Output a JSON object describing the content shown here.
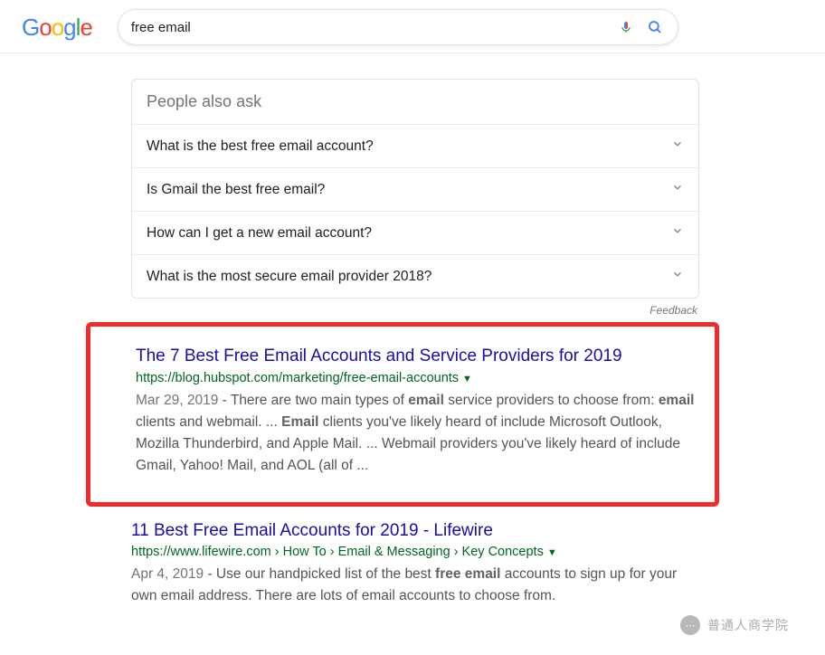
{
  "header": {
    "query": "free email"
  },
  "paa": {
    "title": "People also ask",
    "items": [
      "What is the best free email account?",
      "Is Gmail the best free email?",
      "How can I get a new email account?",
      "What is the most secure email provider 2018?"
    ]
  },
  "feedback_label": "Feedback",
  "results": [
    {
      "title": "The 7 Best Free Email Accounts and Service Providers for 2019",
      "url": "https://blog.hubspot.com/marketing/free-email-accounts",
      "date": "Mar 29, 2019",
      "snippet_parts": [
        " - There are two main types of ",
        "email",
        " service providers to choose from: ",
        "email",
        " clients and webmail. ... ",
        "Email",
        " clients you've likely heard of include Microsoft Outlook, Mozilla Thunderbird, and Apple Mail. ... Webmail providers you've likely heard of include Gmail, Yahoo! Mail, and AOL (all of ..."
      ]
    },
    {
      "title": "11 Best Free Email Accounts for 2019 - Lifewire",
      "url": "https://www.lifewire.com › How To › Email & Messaging › Key Concepts",
      "date": "Apr 4, 2019",
      "snippet_parts": [
        " - Use our handpicked list of the best ",
        "free email",
        " accounts to sign up for your own email address. There are lots of email accounts to choose from."
      ]
    }
  ],
  "watermark": "普通人商学院"
}
